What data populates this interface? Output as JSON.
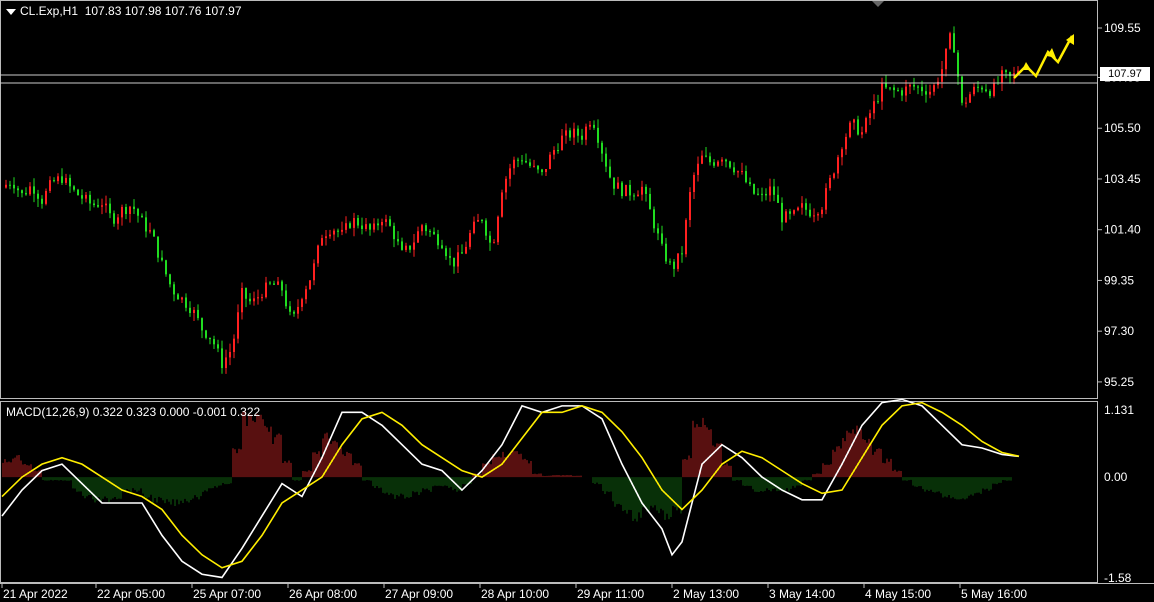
{
  "header": {
    "symbol": "CL.Exp,H1",
    "ohlc": "107.83 107.98 107.76 107.97"
  },
  "macd_header": {
    "label": "MACD(12,26,9)",
    "values": "0.322 0.323 0.000 -0.001 0.322"
  },
  "current_price": "107.97",
  "colors": {
    "background": "#000000",
    "up_candle": "#ff2020",
    "down_candle": "#20dd20",
    "macd_line": "#ffffff",
    "signal_line": "#ffee00",
    "hist_pos": "#b02020",
    "hist_neg": "#106010",
    "arrow": "#ffee00"
  },
  "icons": [
    "dropdown-triangle-icon",
    "forecast-arrow-icon"
  ],
  "chart_data": [
    {
      "type": "candlestick",
      "title": "CL.Exp,H1",
      "y_ticks": [
        "109.55",
        "107.55",
        "105.50",
        "103.45",
        "101.40",
        "99.35",
        "97.30",
        "95.25"
      ],
      "ylim": [
        94.6,
        110.6
      ],
      "x_ticks": [
        "21 Apr 2022",
        "22 Apr 05:00",
        "25 Apr 07:00",
        "26 Apr 08:00",
        "27 Apr 09:00",
        "28 Apr 10:00",
        "29 Apr 11:00",
        "2 May 13:00",
        "3 May 14:00",
        "4 May 15:00",
        "5 May 16:00"
      ],
      "close_path": [
        [
          0,
          103.1
        ],
        [
          10,
          103.4
        ],
        [
          20,
          102.8
        ],
        [
          30,
          103.2
        ],
        [
          40,
          102.6
        ],
        [
          50,
          103.3
        ],
        [
          60,
          103.5
        ],
        [
          70,
          103.0
        ],
        [
          80,
          102.7
        ],
        [
          90,
          102.4
        ],
        [
          100,
          102.5
        ],
        [
          110,
          101.8
        ],
        [
          120,
          102.2
        ],
        [
          130,
          102.4
        ],
        [
          140,
          101.7
        ],
        [
          150,
          101.2
        ],
        [
          160,
          100.0
        ],
        [
          170,
          99.0
        ],
        [
          180,
          98.6
        ],
        [
          190,
          98.2
        ],
        [
          200,
          97.4
        ],
        [
          210,
          97.0
        ],
        [
          220,
          96.0
        ],
        [
          230,
          96.6
        ],
        [
          240,
          98.8
        ],
        [
          250,
          98.4
        ],
        [
          260,
          98.9
        ],
        [
          270,
          99.2
        ],
        [
          280,
          99.0
        ],
        [
          290,
          97.6
        ],
        [
          300,
          98.8
        ],
        [
          310,
          99.6
        ],
        [
          320,
          101.2
        ],
        [
          330,
          101.5
        ],
        [
          340,
          101.2
        ],
        [
          350,
          101.8
        ],
        [
          360,
          101.6
        ],
        [
          370,
          101.3
        ],
        [
          380,
          101.9
        ],
        [
          390,
          101.4
        ],
        [
          400,
          100.4
        ],
        [
          410,
          100.8
        ],
        [
          420,
          101.6
        ],
        [
          430,
          101.2
        ],
        [
          440,
          100.9
        ],
        [
          450,
          100.0
        ],
        [
          460,
          100.4
        ],
        [
          470,
          101.4
        ],
        [
          480,
          101.9
        ],
        [
          490,
          100.6
        ],
        [
          500,
          103.1
        ],
        [
          510,
          104.1
        ],
        [
          520,
          104.3
        ],
        [
          530,
          103.9
        ],
        [
          540,
          103.6
        ],
        [
          550,
          104.5
        ],
        [
          560,
          105.1
        ],
        [
          570,
          105.3
        ],
        [
          580,
          105.2
        ],
        [
          590,
          106.0
        ],
        [
          600,
          104.6
        ],
        [
          610,
          103.3
        ],
        [
          620,
          103.0
        ],
        [
          630,
          102.9
        ],
        [
          640,
          103.1
        ],
        [
          650,
          101.9
        ],
        [
          660,
          100.6
        ],
        [
          670,
          99.8
        ],
        [
          680,
          100.5
        ],
        [
          690,
          103.4
        ],
        [
          700,
          104.3
        ],
        [
          710,
          104.1
        ],
        [
          720,
          104.4
        ],
        [
          730,
          104.0
        ],
        [
          740,
          103.6
        ],
        [
          750,
          102.9
        ],
        [
          760,
          102.7
        ],
        [
          770,
          103.1
        ],
        [
          780,
          101.9
        ],
        [
          790,
          101.9
        ],
        [
          800,
          102.3
        ],
        [
          810,
          102.1
        ],
        [
          820,
          102.4
        ],
        [
          830,
          103.6
        ],
        [
          840,
          104.9
        ],
        [
          850,
          105.7
        ],
        [
          860,
          105.3
        ],
        [
          870,
          106.3
        ],
        [
          880,
          107.1
        ],
        [
          890,
          107.0
        ],
        [
          900,
          107.0
        ],
        [
          910,
          107.2
        ],
        [
          920,
          107.1
        ],
        [
          930,
          107.0
        ],
        [
          940,
          107.9
        ],
        [
          950,
          109.4
        ],
        [
          960,
          106.4
        ],
        [
          970,
          107.0
        ],
        [
          980,
          107.2
        ],
        [
          990,
          107.0
        ],
        [
          1000,
          107.6
        ],
        [
          1010,
          107.5
        ],
        [
          1017,
          107.97
        ]
      ]
    },
    {
      "type": "macd",
      "title": "MACD(12,26,9)",
      "y_ticks": [
        "1.131",
        "0.00",
        "-1.58"
      ],
      "ylim": [
        -1.62,
        1.16
      ],
      "macd_line": [
        [
          0,
          -0.6
        ],
        [
          20,
          -0.2
        ],
        [
          40,
          0.1
        ],
        [
          60,
          0.2
        ],
        [
          80,
          -0.1
        ],
        [
          100,
          -0.4
        ],
        [
          120,
          -0.4
        ],
        [
          140,
          -0.4
        ],
        [
          160,
          -0.9
        ],
        [
          180,
          -1.3
        ],
        [
          200,
          -1.5
        ],
        [
          220,
          -1.55
        ],
        [
          240,
          -1.1
        ],
        [
          260,
          -0.6
        ],
        [
          280,
          -0.1
        ],
        [
          300,
          -0.3
        ],
        [
          320,
          0.3
        ],
        [
          340,
          1.0
        ],
        [
          360,
          1.0
        ],
        [
          380,
          0.8
        ],
        [
          400,
          0.5
        ],
        [
          420,
          0.2
        ],
        [
          440,
          0.1
        ],
        [
          460,
          -0.2
        ],
        [
          480,
          0.1
        ],
        [
          500,
          0.5
        ],
        [
          520,
          1.1
        ],
        [
          540,
          1.0
        ],
        [
          560,
          1.1
        ],
        [
          580,
          1.1
        ],
        [
          600,
          0.9
        ],
        [
          620,
          0.2
        ],
        [
          640,
          -0.4
        ],
        [
          660,
          -0.8
        ],
        [
          670,
          -1.2
        ],
        [
          680,
          -1.0
        ],
        [
          700,
          0.2
        ],
        [
          720,
          0.5
        ],
        [
          740,
          0.3
        ],
        [
          760,
          0.0
        ],
        [
          780,
          -0.2
        ],
        [
          800,
          -0.35
        ],
        [
          820,
          -0.35
        ],
        [
          840,
          0.2
        ],
        [
          860,
          0.8
        ],
        [
          880,
          1.15
        ],
        [
          900,
          1.2
        ],
        [
          920,
          1.1
        ],
        [
          940,
          0.8
        ],
        [
          960,
          0.5
        ],
        [
          980,
          0.45
        ],
        [
          1000,
          0.35
        ],
        [
          1017,
          0.32
        ]
      ],
      "signal_line": [
        [
          0,
          -0.3
        ],
        [
          20,
          0.0
        ],
        [
          40,
          0.2
        ],
        [
          60,
          0.3
        ],
        [
          80,
          0.2
        ],
        [
          100,
          0.0
        ],
        [
          120,
          -0.2
        ],
        [
          140,
          -0.3
        ],
        [
          160,
          -0.5
        ],
        [
          180,
          -0.9
        ],
        [
          200,
          -1.2
        ],
        [
          220,
          -1.4
        ],
        [
          240,
          -1.3
        ],
        [
          260,
          -0.9
        ],
        [
          280,
          -0.4
        ],
        [
          300,
          -0.2
        ],
        [
          320,
          0.0
        ],
        [
          340,
          0.5
        ],
        [
          360,
          0.9
        ],
        [
          380,
          1.0
        ],
        [
          400,
          0.8
        ],
        [
          420,
          0.5
        ],
        [
          440,
          0.3
        ],
        [
          460,
          0.1
        ],
        [
          480,
          0.0
        ],
        [
          500,
          0.2
        ],
        [
          520,
          0.6
        ],
        [
          540,
          1.0
        ],
        [
          560,
          1.0
        ],
        [
          580,
          1.1
        ],
        [
          600,
          1.0
        ],
        [
          620,
          0.7
        ],
        [
          640,
          0.3
        ],
        [
          660,
          -0.2
        ],
        [
          680,
          -0.5
        ],
        [
          700,
          -0.2
        ],
        [
          720,
          0.2
        ],
        [
          740,
          0.4
        ],
        [
          760,
          0.3
        ],
        [
          780,
          0.1
        ],
        [
          800,
          -0.1
        ],
        [
          820,
          -0.25
        ],
        [
          840,
          -0.2
        ],
        [
          860,
          0.3
        ],
        [
          880,
          0.8
        ],
        [
          900,
          1.1
        ],
        [
          920,
          1.15
        ],
        [
          940,
          1.0
        ],
        [
          960,
          0.8
        ],
        [
          980,
          0.55
        ],
        [
          1000,
          0.38
        ],
        [
          1017,
          0.323
        ]
      ],
      "histogram": [
        [
          5,
          0.25
        ],
        [
          15,
          0.3
        ],
        [
          25,
          0.2
        ],
        [
          35,
          0.1
        ],
        [
          45,
          -0.05
        ],
        [
          55,
          -0.05
        ],
        [
          65,
          -0.05
        ],
        [
          75,
          -0.2
        ],
        [
          85,
          -0.3
        ],
        [
          95,
          -0.35
        ],
        [
          105,
          -0.35
        ],
        [
          115,
          -0.3
        ],
        [
          125,
          -0.2
        ],
        [
          135,
          -0.2
        ],
        [
          145,
          -0.3
        ],
        [
          155,
          -0.35
        ],
        [
          165,
          -0.4
        ],
        [
          175,
          -0.4
        ],
        [
          185,
          -0.35
        ],
        [
          195,
          -0.3
        ],
        [
          205,
          -0.2
        ],
        [
          215,
          -0.15
        ],
        [
          225,
          -0.1
        ],
        [
          235,
          0.4
        ],
        [
          245,
          0.9
        ],
        [
          255,
          0.95
        ],
        [
          265,
          0.8
        ],
        [
          275,
          0.6
        ],
        [
          285,
          0.25
        ],
        [
          295,
          -0.05
        ],
        [
          305,
          0.1
        ],
        [
          315,
          0.35
        ],
        [
          325,
          0.6
        ],
        [
          335,
          0.5
        ],
        [
          345,
          0.35
        ],
        [
          355,
          0.2
        ],
        [
          365,
          -0.05
        ],
        [
          375,
          -0.15
        ],
        [
          385,
          -0.25
        ],
        [
          395,
          -0.3
        ],
        [
          405,
          -0.3
        ],
        [
          415,
          -0.25
        ],
        [
          425,
          -0.2
        ],
        [
          435,
          -0.15
        ],
        [
          445,
          -0.15
        ],
        [
          455,
          -0.2
        ],
        [
          465,
          -0.1
        ],
        [
          475,
          0.05
        ],
        [
          485,
          0.2
        ],
        [
          495,
          0.35
        ],
        [
          505,
          0.35
        ],
        [
          515,
          0.4
        ],
        [
          525,
          0.25
        ],
        [
          535,
          0.05
        ],
        [
          545,
          0.02
        ],
        [
          555,
          0.03
        ],
        [
          565,
          0.03
        ],
        [
          575,
          0.02
        ],
        [
          585,
          0.0
        ],
        [
          595,
          -0.1
        ],
        [
          605,
          -0.25
        ],
        [
          615,
          -0.4
        ],
        [
          625,
          -0.5
        ],
        [
          635,
          -0.6
        ],
        [
          645,
          -0.5
        ],
        [
          655,
          -0.5
        ],
        [
          665,
          -0.6
        ],
        [
          675,
          -0.5
        ],
        [
          685,
          0.3
        ],
        [
          695,
          0.9
        ],
        [
          705,
          0.8
        ],
        [
          715,
          0.5
        ],
        [
          725,
          0.2
        ],
        [
          735,
          -0.05
        ],
        [
          745,
          -0.15
        ],
        [
          755,
          -0.2
        ],
        [
          765,
          -0.2
        ],
        [
          775,
          -0.2
        ],
        [
          785,
          -0.2
        ],
        [
          795,
          -0.15
        ],
        [
          805,
          -0.05
        ],
        [
          815,
          0.05
        ],
        [
          825,
          0.2
        ],
        [
          835,
          0.45
        ],
        [
          845,
          0.65
        ],
        [
          855,
          0.7
        ],
        [
          865,
          0.6
        ],
        [
          875,
          0.4
        ],
        [
          885,
          0.25
        ],
        [
          895,
          0.1
        ],
        [
          905,
          -0.05
        ],
        [
          915,
          -0.15
        ],
        [
          925,
          -0.2
        ],
        [
          935,
          -0.25
        ],
        [
          945,
          -0.3
        ],
        [
          955,
          -0.35
        ],
        [
          965,
          -0.3
        ],
        [
          975,
          -0.25
        ],
        [
          985,
          -0.2
        ],
        [
          995,
          -0.1
        ],
        [
          1005,
          -0.05
        ],
        [
          1015,
          0.0
        ]
      ]
    }
  ]
}
